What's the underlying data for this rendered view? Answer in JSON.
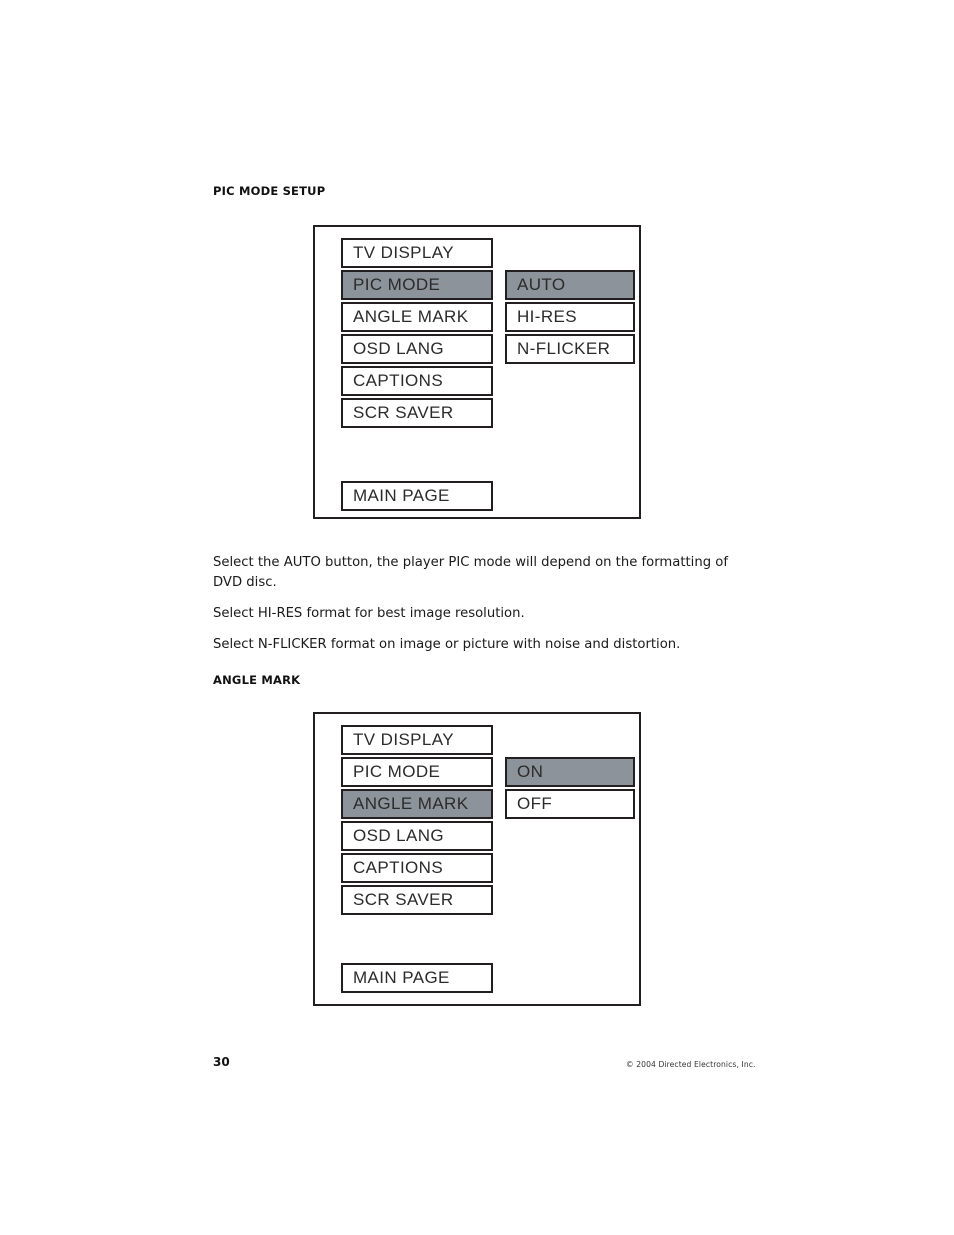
{
  "page": {
    "number": "30",
    "copyright": "© 2004 Directed Electronics, Inc."
  },
  "colors": {
    "highlight": "#8d939a",
    "border": "#231f20",
    "background": "#ffffff",
    "text": "#1a1a1a"
  },
  "sections": {
    "pic_mode": {
      "heading": "PIC MODE SETUP",
      "osd": {
        "menu_items": [
          {
            "label": "TV DISPLAY",
            "selected": false
          },
          {
            "label": "PIC MODE",
            "selected": true
          },
          {
            "label": "ANGLE MARK",
            "selected": false
          },
          {
            "label": "OSD LANG",
            "selected": false
          },
          {
            "label": "CAPTIONS",
            "selected": false
          },
          {
            "label": "SCR SAVER",
            "selected": false
          }
        ],
        "options": [
          {
            "label": "AUTO",
            "selected": true
          },
          {
            "label": "HI-RES",
            "selected": false
          },
          {
            "label": "N-FLICKER",
            "selected": false
          }
        ],
        "main_page": "MAIN PAGE"
      },
      "paragraphs": [
        "Select the AUTO button, the player PIC mode will depend on the formatting of DVD disc.",
        "Select HI-RES format for best image resolution.",
        "Select N-FLICKER format on image or picture with noise and distortion."
      ]
    },
    "angle_mark": {
      "heading": "ANGLE MARK",
      "osd": {
        "menu_items": [
          {
            "label": "TV DISPLAY",
            "selected": false
          },
          {
            "label": "PIC MODE",
            "selected": false
          },
          {
            "label": "ANGLE MARK",
            "selected": true
          },
          {
            "label": "OSD LANG",
            "selected": false
          },
          {
            "label": "CAPTIONS",
            "selected": false
          },
          {
            "label": "SCR SAVER",
            "selected": false
          }
        ],
        "options": [
          {
            "label": "ON",
            "selected": true
          },
          {
            "label": "OFF",
            "selected": false
          }
        ],
        "main_page": "MAIN PAGE"
      }
    }
  }
}
